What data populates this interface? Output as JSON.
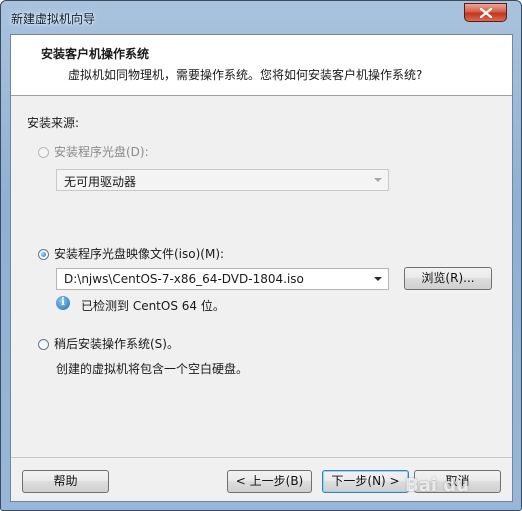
{
  "window": {
    "title": "新建虚拟机向导"
  },
  "header": {
    "title": "安装客户机操作系统",
    "subtitle": "虚拟机如同物理机，需要操作系统。您将如何安装客户机操作系统?"
  },
  "source": {
    "label": "安装来源:",
    "disc": {
      "label": "安装程序光盘(D):",
      "selected": false,
      "enabled": false,
      "combo_value": "无可用驱动器"
    },
    "iso": {
      "label": "安装程序光盘映像文件(iso)(M):",
      "selected": true,
      "combo_value": "D:\\njws\\CentOS-7-x86_64-DVD-1804.iso",
      "browse_label": "浏览(R)...",
      "detected_text": "已检测到 CentOS 64 位。"
    },
    "later": {
      "label": "稍后安装操作系统(S)。",
      "selected": false,
      "description": "创建的虚拟机将包含一个空白硬盘。"
    }
  },
  "footer": {
    "help_label": "帮助",
    "back_label": "< 上一步(B)",
    "next_label": "下一步(N) >",
    "cancel_label": "取消"
  },
  "watermark": {
    "text": "Bai du"
  },
  "icons": {
    "close": "close-icon",
    "info": "info-icon"
  }
}
